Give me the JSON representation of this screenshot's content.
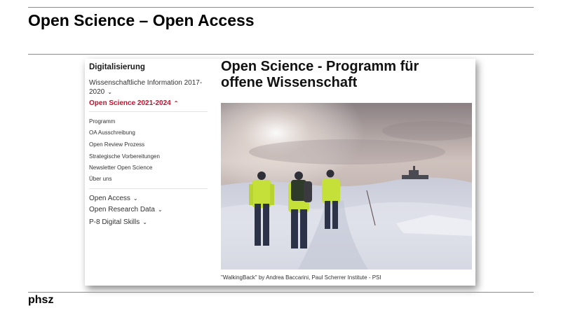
{
  "slide": {
    "title": "Open Science – Open Access",
    "footer_logo": "phsz"
  },
  "sidebar": {
    "heading": "Digitalisierung",
    "level1_top": [
      {
        "label": "Wissenschaftliche Information 2017-2020",
        "expanded": false
      },
      {
        "label": "Open Science 2021-2024",
        "expanded": true,
        "active": true
      }
    ],
    "sub_items": [
      "Programm",
      "OA Ausschreibung",
      "Open Review Prozess",
      "Strategische Vorbereitungen",
      "Newsletter Open Science",
      "Über uns"
    ],
    "level1_bottom": [
      {
        "label": "Open Access",
        "expanded": false
      },
      {
        "label": "Open Research Data",
        "expanded": false
      },
      {
        "label": "P-8 Digital Skills",
        "expanded": false
      }
    ]
  },
  "main": {
    "heading": "Open Science - Programm für offene Wissenschaft",
    "image_caption": "\"WalkingBack\" by Andrea Baccarini, Paul Scherrer Institute - PSI"
  },
  "colors": {
    "accent": "#c8102e",
    "text": "#1a1a1a",
    "rule": "#8a8a8a"
  },
  "icons": {
    "collapsed": "chevron-down-icon",
    "expanded": "chevron-up-icon"
  }
}
